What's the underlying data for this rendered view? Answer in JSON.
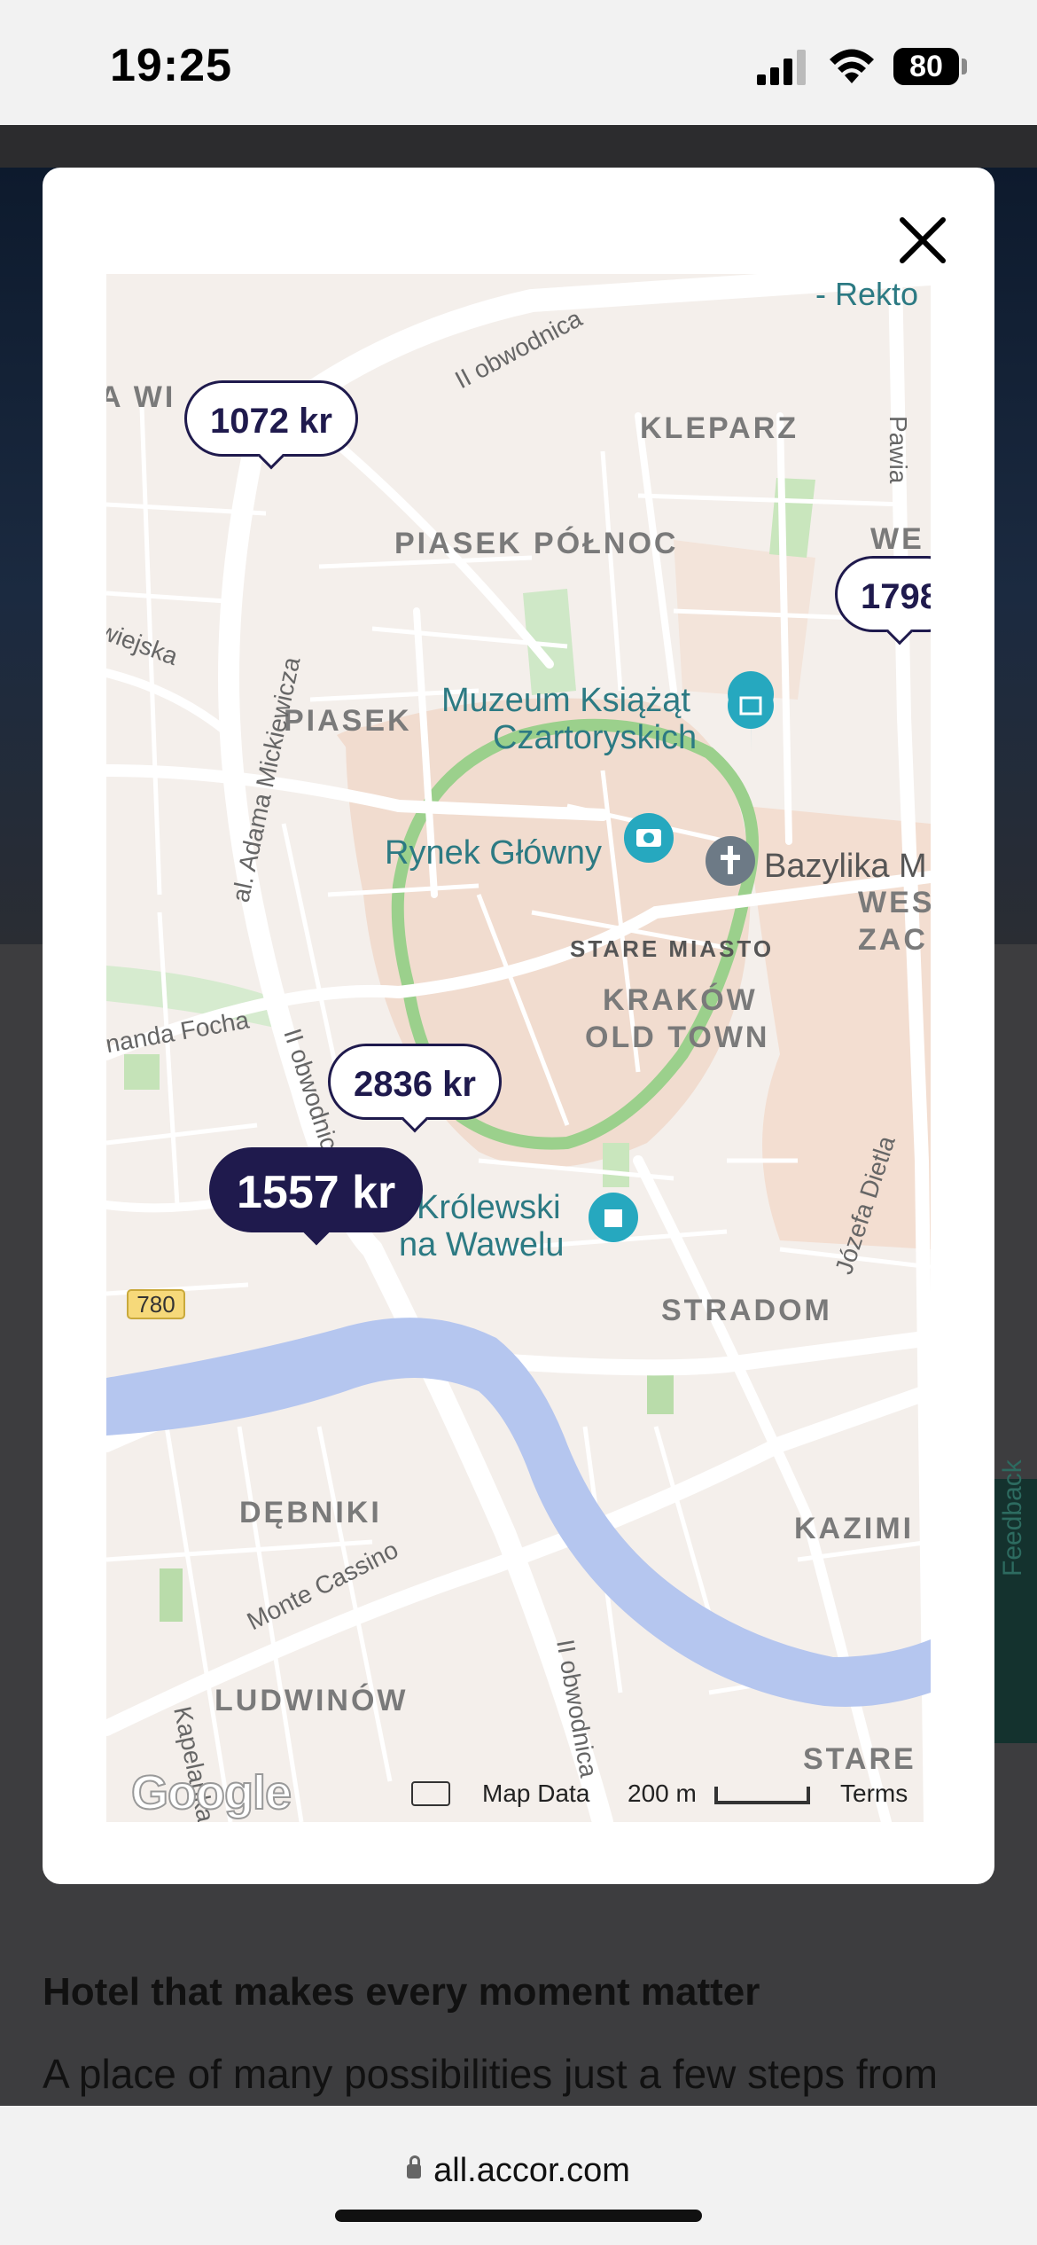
{
  "status_bar": {
    "time": "19:25",
    "battery": "80",
    "icons": [
      "signal-icon",
      "wifi-icon",
      "battery-icon"
    ]
  },
  "modal": {
    "close_icon": "close-icon",
    "map": {
      "price_pins": [
        {
          "label": "1072 kr",
          "selected": false
        },
        {
          "label": "1798",
          "selected": false
        },
        {
          "label": "2836 kr",
          "selected": false
        },
        {
          "label": "1557 kr",
          "selected": true
        }
      ],
      "labels": {
        "rekto": "- Rekto",
        "kleparz": "KLEPARZ",
        "piasek_polnoc": "PIASEK PÓŁNOC",
        "piasek": "PIASEK",
        "muzeum_1": "Muzeum Książąt",
        "muzeum_2": "Czartoryskich",
        "rynek": "Rynek Główny",
        "bazylika": "Bazylika M",
        "stare_miasto": "STARE MIASTO",
        "krakow": "KRAKÓW",
        "old_town": "OLD TOWN",
        "krolewski": "Królewski",
        "na_wawelu": "na Wawelu",
        "stradom": "STRADOM",
        "debniki": "DĘBNIKI",
        "ludwinow": "LUDWINÓW",
        "kazimi": "KAZIMI",
        "stare_bottom": "STARE",
        "we": "WE",
        "wes": "WES",
        "zac": "ZAC",
        "a_wi": "A WI",
        "wiejska": "wiejska",
        "mickiewicza": "al. Adama Mickiewicza",
        "obwodnica_top": "II obwodnica",
        "obwodnica_mid": "II obwodnica",
        "obwodnica_bottom": "II obwodnica",
        "focha": "rnanda Focha",
        "monte_cassino": "Monte Cassino",
        "jozefa_dietla": "Józefa Dietla",
        "pawia": "Pawia",
        "kapelanka": "Kapelanka",
        "road_780": "780"
      },
      "attribution": {
        "logo": "Google",
        "map_data": "Map Data",
        "scale": "200 m",
        "terms": "Terms"
      }
    }
  },
  "background_page": {
    "heading": "Hotel that makes every moment matter",
    "text": "A place of many possibilities just a few steps from",
    "feedback_tab": "Feedback"
  },
  "browser": {
    "url": "all.accor.com"
  }
}
